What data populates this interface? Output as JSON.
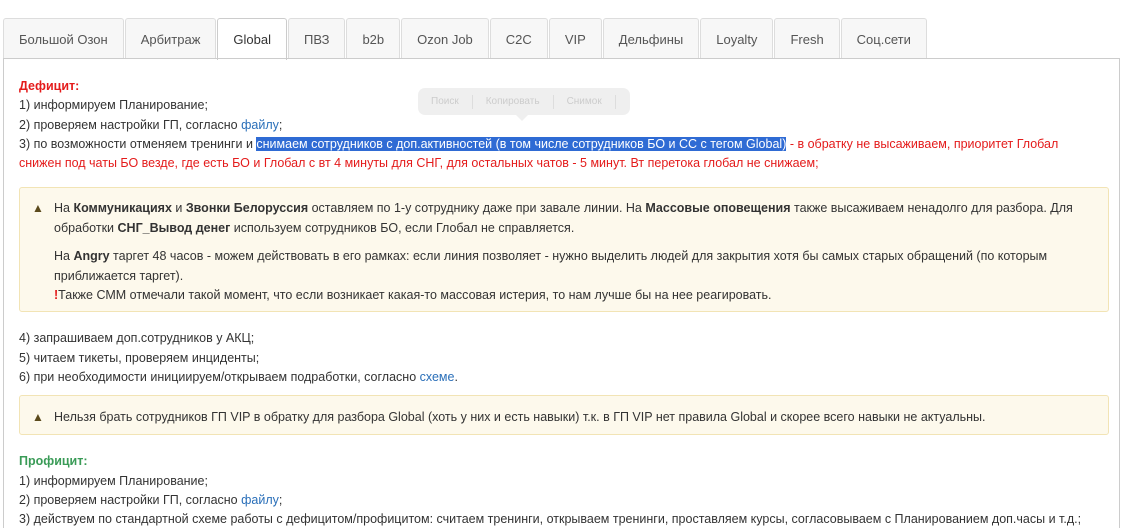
{
  "tabs": [
    {
      "label": "Большой Озон",
      "active": false
    },
    {
      "label": "Арбитраж",
      "active": false
    },
    {
      "label": "Global",
      "active": true
    },
    {
      "label": "ПВЗ",
      "active": false
    },
    {
      "label": "b2b",
      "active": false
    },
    {
      "label": "Ozon Job",
      "active": false
    },
    {
      "label": "C2C",
      "active": false
    },
    {
      "label": "VIP",
      "active": false
    },
    {
      "label": "Дельфины",
      "active": false
    },
    {
      "label": "Loyalty",
      "active": false
    },
    {
      "label": "Fresh",
      "active": false
    },
    {
      "label": "Соц.сети",
      "active": false
    }
  ],
  "selection_toolbar": {
    "search": "Поиск",
    "copy": "Копировать",
    "snapshot": "Снимок"
  },
  "deficit": {
    "heading": "Дефицит:",
    "item1": "1) информируем Планирование;",
    "item2_prefix": "2) проверяем настройки ГП, согласно ",
    "item2_link": "файлу",
    "item2_suffix": ";",
    "item3_prefix": "3) по возможности отменяем тренинги и ",
    "item3_highlight": "снимаем сотрудников с доп.активностей (в том числе сотрудников БО и СС с тегом Global)",
    "item3_red1": " - в обратку не высаживаем, приоритет Глобал",
    "item3_red2": "снижен под чаты БО везде, где есть БО и Глобал с вт 4 минуты для СНГ, для остальных чатов - 5 минут. Вт перетока глобал не снижаем;"
  },
  "alert1": {
    "p1_a": "На ",
    "p1_b": "Коммуникациях",
    "p1_c": " и ",
    "p1_d": "Звонки Белоруссия",
    "p1_e": " оставляем по 1-у сотруднику даже при завале линии. На ",
    "p1_f": "Массовые оповещения",
    "p1_g": " также высаживаем ненадолго для разбора. Для",
    "p1_h": "обработки ",
    "p1_i": "СНГ_Вывод денег",
    "p1_j": " используем сотрудников БО, если Глобал не справляется.",
    "p2_a": "На ",
    "p2_b": "Angry",
    "p2_c": " таргет 48 часов - можем действовать в его рамках: если линия позволяет - нужно выделить людей для закрытия хотя бы самых старых обращений (по которым",
    "p2_d": "приближается таргет).",
    "p3_excl": "!",
    "p3_text": "Также СММ отмечали такой момент, что если возникает какая-то массовая истерия, то нам лучше бы на нее реагировать."
  },
  "deficit_more": {
    "item4": "4) запрашиваем доп.сотрудников у АКЦ;",
    "item5": "5) читаем тикеты, проверяем инциденты;",
    "item6_prefix": "6) при необходимости инициируем/открываем подработки, согласно ",
    "item6_link": "схеме",
    "item6_suffix": "."
  },
  "alert2": {
    "text": "Нельзя брать сотрудников ГП VIP в обратку для разбора Global (хоть у них и есть навыки) т.к. в ГП VIP нет правила Global и скорее всего навыки не актуальны."
  },
  "profit": {
    "heading": "Профицит:",
    "item1": "1) информируем Планирование;",
    "item2_prefix": "2) проверяем настройки ГП, согласно ",
    "item2_link": "файлу",
    "item2_suffix": ";",
    "item3": "3) действуем по стандартной схеме работы с дефицитом/профицитом: считаем тренинги, открываем тренинги, проставляем курсы, согласовываем с Планированием доп.часы и т.д.;"
  },
  "icons": {
    "warning": "warning-icon"
  }
}
